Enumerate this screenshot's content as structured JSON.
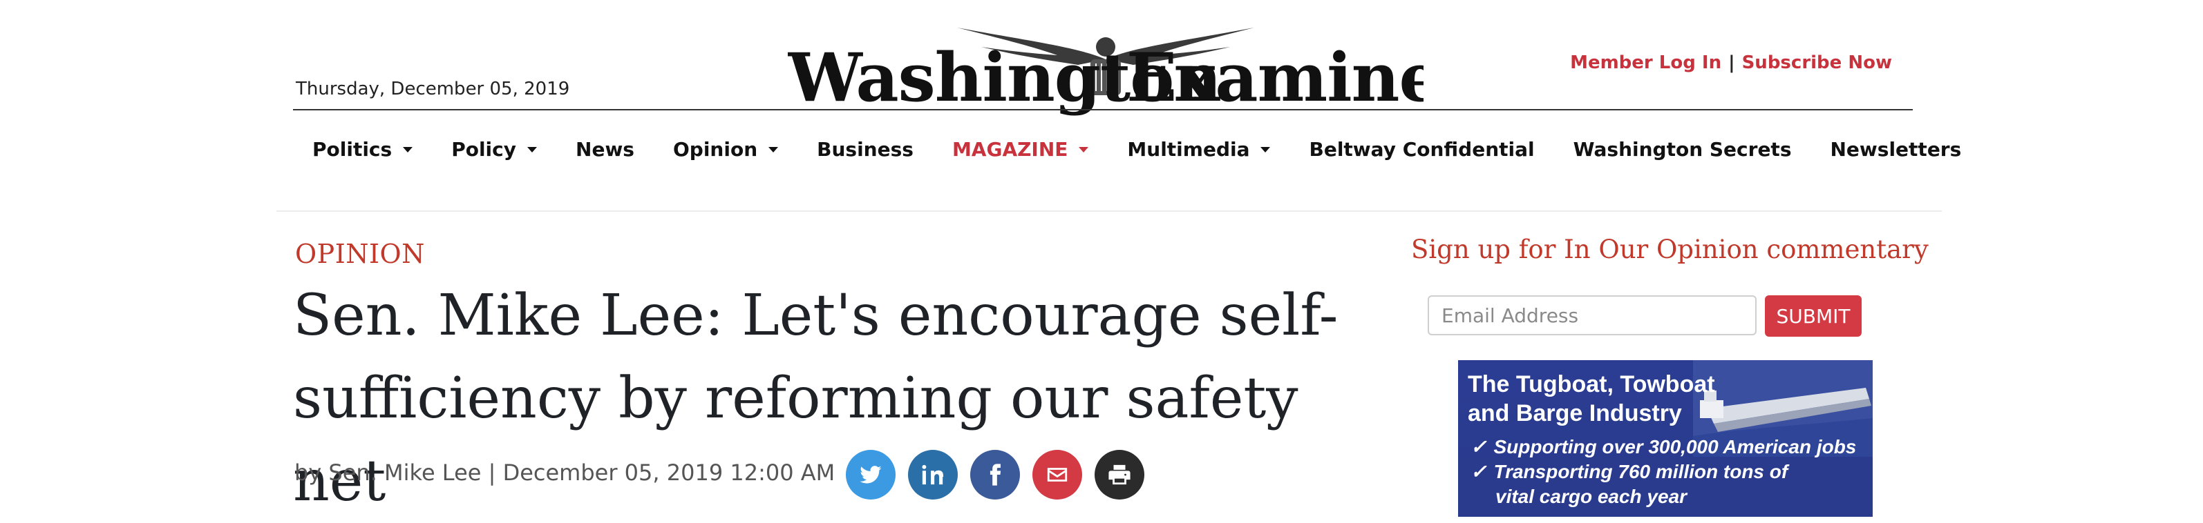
{
  "header": {
    "date": "Thursday, December 05, 2019",
    "masthead": "Washington Examiner",
    "member_login": "Member Log In",
    "separator": "|",
    "subscribe": "Subscribe Now"
  },
  "nav": {
    "items": [
      {
        "label": "Politics",
        "dropdown": true
      },
      {
        "label": "Policy",
        "dropdown": true
      },
      {
        "label": "News",
        "dropdown": false
      },
      {
        "label": "Opinion",
        "dropdown": true
      },
      {
        "label": "Business",
        "dropdown": false
      },
      {
        "label": "MAGAZINE",
        "dropdown": true,
        "accent": true
      },
      {
        "label": "Multimedia",
        "dropdown": true
      },
      {
        "label": "Beltway Confidential",
        "dropdown": false
      },
      {
        "label": "Washington Secrets",
        "dropdown": false
      },
      {
        "label": "Newsletters",
        "dropdown": false
      }
    ]
  },
  "article": {
    "kicker": "OPINION",
    "headline": "Sen. Mike Lee: Let's encourage self-sufficiency by reforming our safety net",
    "byline": "by Sen. Mike Lee | December 05, 2019 12:00 AM",
    "share": [
      {
        "icon": "twitter-icon",
        "color": "#3b9ae1"
      },
      {
        "icon": "linkedin-icon",
        "color": "#2a6fa8"
      },
      {
        "icon": "facebook-icon",
        "color": "#3b5a9a"
      },
      {
        "icon": "email-icon",
        "color": "#d33a44"
      },
      {
        "icon": "print-icon",
        "color": "#2b2b2b"
      }
    ]
  },
  "sidebar": {
    "signup_title": "Sign up for In Our Opinion commentary",
    "email_placeholder": "Email Address",
    "submit_label": "SUBMIT",
    "ad": {
      "title": "The Tugboat, Towboat and Barge Industry",
      "bullets": [
        "Supporting over 300,000 American jobs",
        "Transporting 760 million tons of",
        "vital cargo each year"
      ],
      "background": "#2b3d93"
    }
  },
  "colors": {
    "accent": "#c8323c",
    "kicker": "#c0392b",
    "text": "#1f2328"
  }
}
